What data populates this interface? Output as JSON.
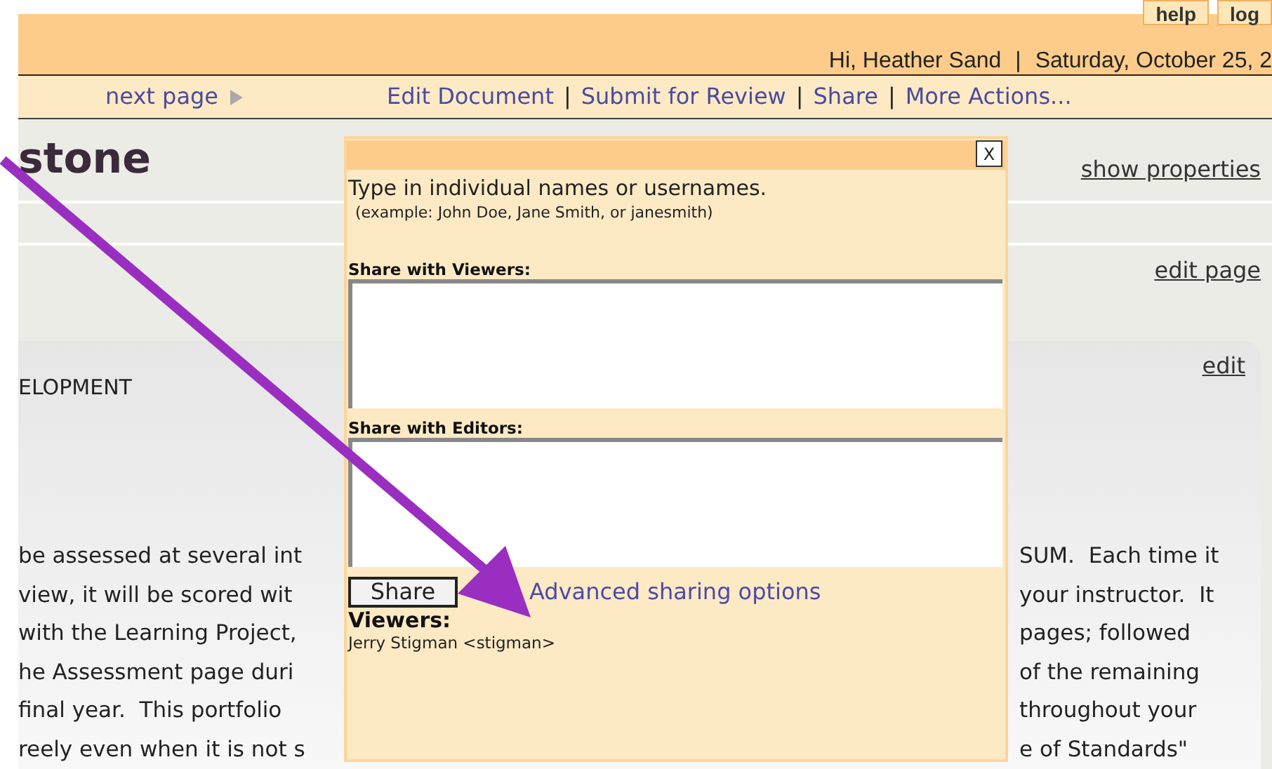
{
  "header": {
    "top_buttons": [
      "help",
      "log"
    ],
    "greeting": "Hi, Heather Sand",
    "separator": "|",
    "date": "Saturday, October 25, 2"
  },
  "nav": {
    "next_page": "next page",
    "actions": [
      {
        "kind": "link",
        "text": "Edit Document"
      },
      {
        "kind": "separator",
        "text": "|"
      },
      {
        "kind": "link",
        "text": "Submit for Review"
      },
      {
        "kind": "separator",
        "text": "|"
      },
      {
        "kind": "link",
        "text": "Share"
      },
      {
        "kind": "separator",
        "text": "|"
      },
      {
        "kind": "link",
        "text": "More Actions..."
      }
    ]
  },
  "page": {
    "title": "stone",
    "show_properties": "show properties",
    "edit_page": "edit page",
    "section": "ELOPMENT",
    "edit": "edit",
    "body_rows": [
      {
        "left": "be assessed at several int",
        "right": "SUM.  Each time it"
      },
      {
        "left": "view, it will be scored wit",
        "right": "your instructor.  It"
      },
      {
        "left": "with the Learning Project,",
        "right": "pages; followed"
      },
      {
        "left": "he Assessment page duri",
        "right": "of the remaining"
      },
      {
        "left": "final year.  This portfolio",
        "right": "throughout your"
      },
      {
        "left": "reely even when it is not s",
        "right": "e of Standards\""
      }
    ]
  },
  "dialog": {
    "close": "X",
    "instruction": "Type in individual names or usernames.",
    "example": "(example: John Doe, Jane Smith, or janesmith)",
    "viewers_label": "Share with Viewers:",
    "editors_label": "Share with Editors:",
    "share_button": "Share",
    "advanced_link": "Advanced sharing options",
    "viewers_heading": "Viewers:",
    "viewers": [
      "Jerry Stigman <stigman>"
    ]
  }
}
